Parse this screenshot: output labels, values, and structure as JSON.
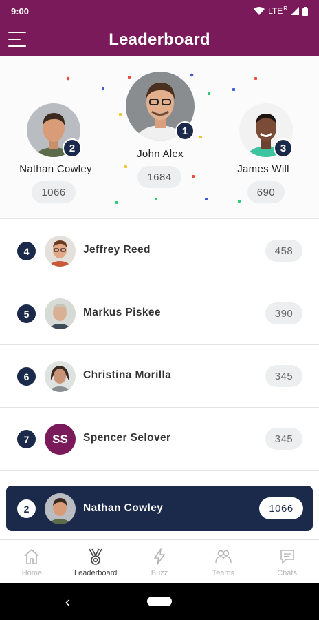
{
  "status": {
    "time": "9:00",
    "network": "LTE",
    "roaming": "R"
  },
  "header": {
    "title": "Leaderboard"
  },
  "podium": [
    {
      "rank": "1",
      "name": "John Alex",
      "score": "1684"
    },
    {
      "rank": "2",
      "name": "Nathan Cowley",
      "score": "1066"
    },
    {
      "rank": "3",
      "name": "James Will",
      "score": "690"
    }
  ],
  "list": [
    {
      "rank": "4",
      "name": "Jeffrey Reed",
      "score": "458"
    },
    {
      "rank": "5",
      "name": "Markus Piskee",
      "score": "390"
    },
    {
      "rank": "6",
      "name": "Christina Morilla",
      "score": "345"
    },
    {
      "rank": "7",
      "name": "Spencer Selover",
      "score": "345",
      "initials": "SS"
    }
  ],
  "current_user": {
    "rank": "2",
    "name": "Nathan Cowley",
    "score": "1066"
  },
  "nav": {
    "home": "Home",
    "leaderboard": "Leaderboard",
    "buzz": "Buzz",
    "teams": "Teams",
    "chats": "Chats"
  },
  "colors": {
    "brand": "#7b1a5b",
    "navy": "#1b2a4a"
  },
  "icons": [
    "menu-icon",
    "home-icon",
    "trophy-icon",
    "lightning-icon",
    "teams-icon",
    "chat-icon",
    "back-icon"
  ]
}
